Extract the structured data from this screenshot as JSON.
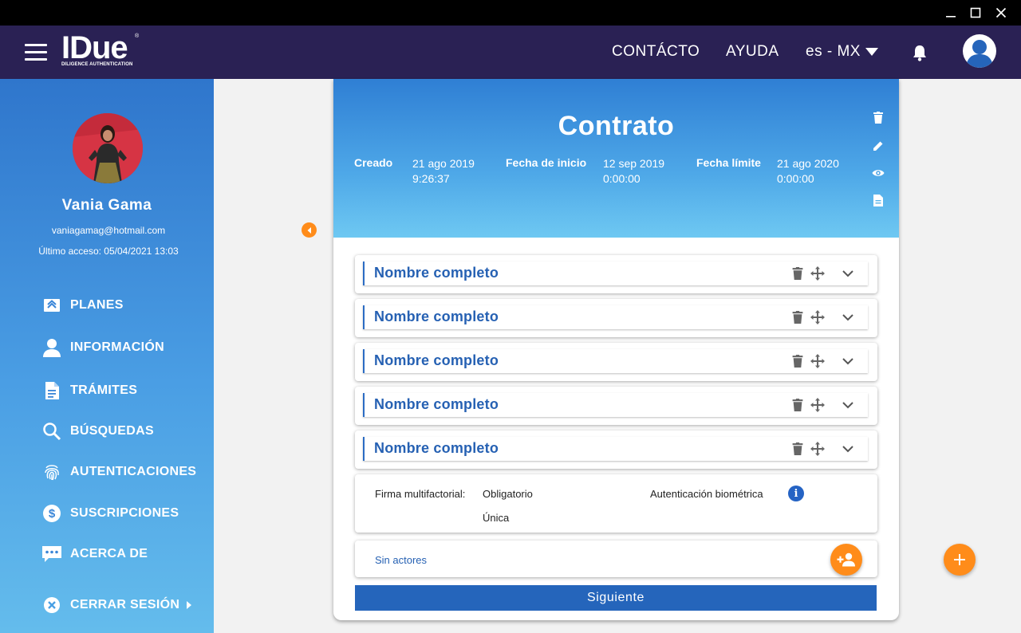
{
  "window": {
    "controls": [
      "minimize-icon",
      "maximize-icon",
      "close-icon"
    ]
  },
  "header": {
    "logo": {
      "main": "IDue",
      "registered": "®",
      "subtitle": "DILIGENCE AUTHENTICATION"
    },
    "nav": {
      "contact": "CONTÁCTO",
      "help": "AYUDA",
      "language": "es - MX"
    },
    "colors": {
      "background": "#2a2154"
    }
  },
  "sidebar": {
    "user": {
      "name": "Vania Gama",
      "email": "vaniagamag@hotmail.com",
      "last_access": "Último acceso: 05/04/2021 13:03"
    },
    "items": [
      {
        "label": "PLANES",
        "icon": "plans-icon"
      },
      {
        "label": "INFORMACIÓN",
        "icon": "person-icon"
      },
      {
        "label": "TRÁMITES",
        "icon": "document-icon"
      },
      {
        "label": "BÚSQUEDAS",
        "icon": "search-icon"
      },
      {
        "label": "AUTENTICACIONES",
        "icon": "fingerprint-icon"
      },
      {
        "label": "SUSCRIPCIONES",
        "icon": "dollar-icon"
      },
      {
        "label": "ACERCA DE",
        "icon": "chat-icon"
      },
      {
        "label": "CERRAR SESIÓN",
        "icon": "close-circle-icon"
      }
    ]
  },
  "contract": {
    "title": "Contrato",
    "created": {
      "label": "Creado",
      "date": "21 ago 2019",
      "time": "9:26:37"
    },
    "start": {
      "label": "Fecha de inicio",
      "date": "12 sep 2019",
      "time": "0:00:00"
    },
    "deadline": {
      "label": "Fecha límite",
      "date": "21 ago 2020",
      "time": "0:00:00"
    },
    "header_actions": [
      "trash-icon",
      "pencil-icon",
      "eye-icon",
      "file-icon"
    ],
    "actors": [
      {
        "name": "Nombre completo"
      },
      {
        "name": "Nombre completo"
      },
      {
        "name": "Nombre completo"
      },
      {
        "name": "Nombre completo"
      },
      {
        "name": "Nombre completo"
      }
    ],
    "auth": {
      "multifactor_label": "Firma multifactorial:",
      "required": "Obligatorio",
      "unique": "Única",
      "biometric": "Autenticación biométrica"
    },
    "no_actors": "Sin actores",
    "next_button": "Siguiente"
  },
  "colors": {
    "accent": "#ff8c1a",
    "primary": "#2565bb",
    "actor_text": "#2661b3"
  }
}
